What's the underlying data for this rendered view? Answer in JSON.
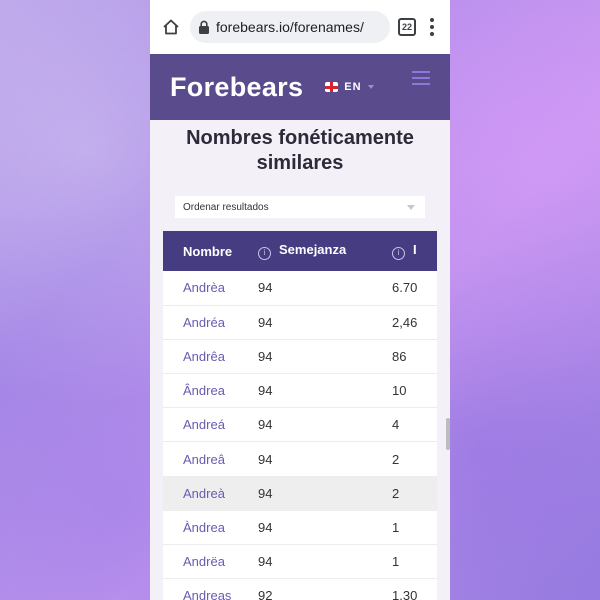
{
  "browser": {
    "url": "forebears.io/forenames/",
    "tab_count": "22"
  },
  "site": {
    "logo": "Forebears",
    "language": "EN"
  },
  "section": {
    "title": "Nombres fonéticamente similares",
    "sort_label": "Ordenar resultados"
  },
  "table": {
    "headers": [
      "Nombre",
      "Semejanza",
      "I"
    ],
    "rows": [
      {
        "name": "Andrèa",
        "similarity": "94",
        "incidence": "6.70"
      },
      {
        "name": "Andréa",
        "similarity": "94",
        "incidence": "2,46"
      },
      {
        "name": "Andrêa",
        "similarity": "94",
        "incidence": "86"
      },
      {
        "name": "Ândrea",
        "similarity": "94",
        "incidence": "10"
      },
      {
        "name": "Andreá",
        "similarity": "94",
        "incidence": "4"
      },
      {
        "name": "Andreâ",
        "similarity": "94",
        "incidence": "2"
      },
      {
        "name": "Andreà",
        "similarity": "94",
        "incidence": "2"
      },
      {
        "name": "Àndrea",
        "similarity": "94",
        "incidence": "1"
      },
      {
        "name": "Andrëa",
        "similarity": "94",
        "incidence": "1"
      },
      {
        "name": "Andreas",
        "similarity": "92",
        "incidence": "1,30"
      }
    ]
  },
  "colors": {
    "header_bg": "#5a4b8c",
    "table_header_bg": "#463c82",
    "name_link": "#6a5bb0"
  }
}
